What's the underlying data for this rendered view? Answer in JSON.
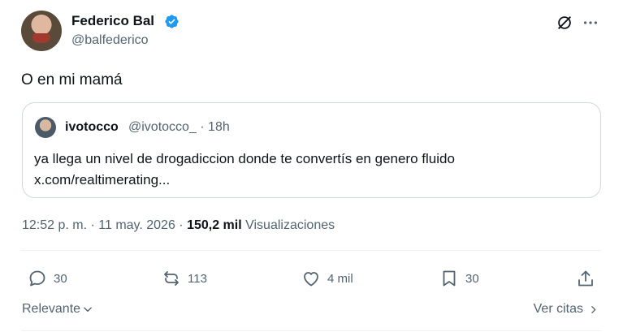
{
  "author": {
    "name": "Federico Bal",
    "handle": "@balfederico",
    "verified": true,
    "verified_color": "#1d9bf0"
  },
  "tweet": {
    "text": "O en mi mamá"
  },
  "quoted": {
    "name": "ivotocco",
    "meta": "@ivotocco_ · 18h",
    "text": "ya llega un nivel de drogadiccion donde te convertís en genero fluido",
    "link": "x.com/realtimerating..."
  },
  "meta": {
    "time_date": "12:52 p. m. · 11 may. 2026 · ",
    "views_count": "150,2 mil",
    "views_label": " Visualizaciones"
  },
  "actions": {
    "replies": "30",
    "reposts": "113",
    "likes": "4 mil",
    "bookmarks": "30"
  },
  "footer": {
    "sort_label": "Relevante",
    "quotes_label": "Ver citas"
  },
  "colors": {
    "text_primary": "#0f1419",
    "text_secondary": "#536471",
    "border": "#cfd9de"
  },
  "icons": [
    "grok-icon",
    "more-icon",
    "reply-icon",
    "repost-icon",
    "like-icon",
    "bookmark-icon",
    "share-icon",
    "chevron-down-icon",
    "chevron-right-icon"
  ]
}
